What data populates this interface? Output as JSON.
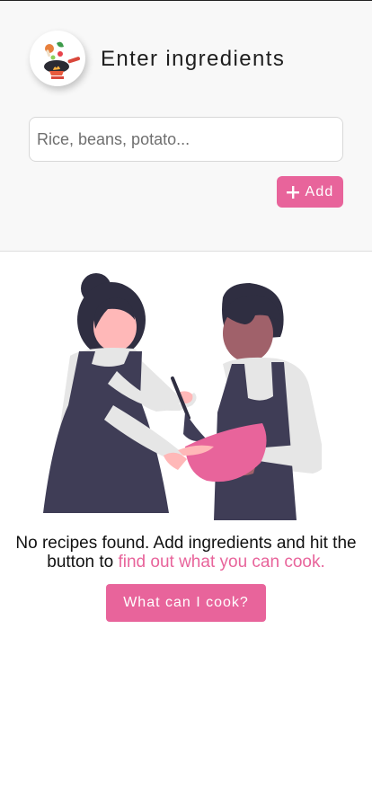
{
  "header": {
    "title": "Enter ingredients",
    "logo_icon": "cooking-pan-icon"
  },
  "search": {
    "placeholder": "Rice, beans, potato...",
    "value": ""
  },
  "add_button": {
    "label": "Add",
    "icon": "plus-icon"
  },
  "illustration": {
    "icon": "two-people-cooking-illustration"
  },
  "empty_state": {
    "message_plain": "No recipes found. Add ingredients and hit the button to ",
    "message_accent": "find out what you can cook."
  },
  "cook_button": {
    "label": "What can I cook?"
  },
  "colors": {
    "accent": "#e8649b",
    "panel_background": "#f8f8f8",
    "dark_figure": "#3f3d56",
    "skin_light": "#ffb8b8",
    "skin_dark": "#a0616a",
    "shirt": "#e6e6e6"
  }
}
